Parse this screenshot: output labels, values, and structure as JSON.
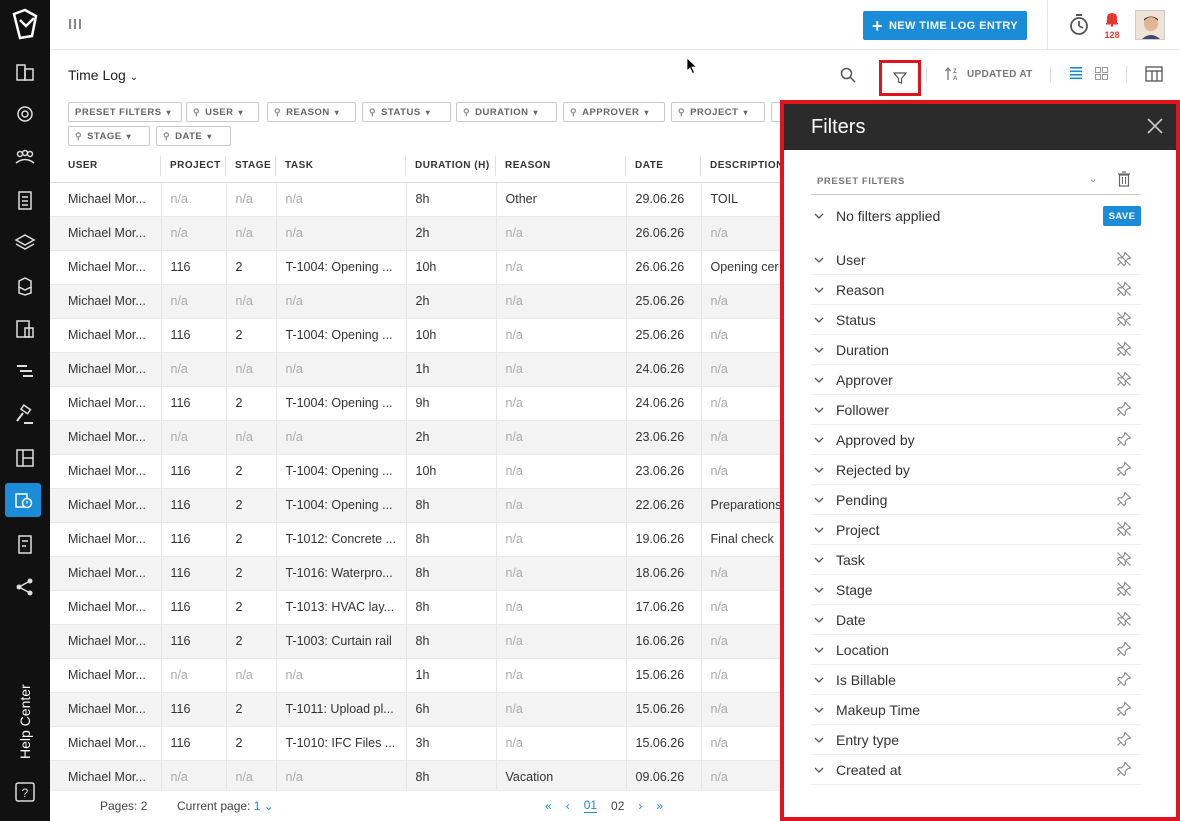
{
  "header": {
    "new_entry_label": "NEW TIME LOG ENTRY",
    "notification_count": "128"
  },
  "toolbar": {
    "page_title": "Time Log",
    "sort_label": "UPDATED AT"
  },
  "chips": {
    "preset": "PRESET FILTERS",
    "user": "USER",
    "reason": "REASON",
    "status": "STATUS",
    "duration": "DURATION",
    "approver": "APPROVER",
    "project": "PROJECT",
    "stage": "STAGE",
    "date": "DATE"
  },
  "table": {
    "headers": {
      "user": "USER",
      "project": "PROJECT",
      "stage": "STAGE",
      "task": "TASK",
      "duration": "DURATION (H)",
      "reason": "REASON",
      "date": "DATE",
      "description": "DESCRIPTION"
    },
    "rows": [
      {
        "user": "Michael Mor...",
        "project": "n/a",
        "stage": "n/a",
        "task": "n/a",
        "duration": "8h",
        "reason": "Other",
        "date": "29.06.26",
        "description": "TOIL"
      },
      {
        "user": "Michael Mor...",
        "project": "n/a",
        "stage": "n/a",
        "task": "n/a",
        "duration": "2h",
        "reason": "n/a",
        "date": "26.06.26",
        "description": "n/a"
      },
      {
        "user": "Michael Mor...",
        "project": "116",
        "stage": "2",
        "task": "T-1004: Opening ...",
        "duration": "10h",
        "reason": "n/a",
        "date": "26.06.26",
        "description": "Opening cer"
      },
      {
        "user": "Michael Mor...",
        "project": "n/a",
        "stage": "n/a",
        "task": "n/a",
        "duration": "2h",
        "reason": "n/a",
        "date": "25.06.26",
        "description": "n/a"
      },
      {
        "user": "Michael Mor...",
        "project": "116",
        "stage": "2",
        "task": "T-1004: Opening ...",
        "duration": "10h",
        "reason": "n/a",
        "date": "25.06.26",
        "description": "n/a"
      },
      {
        "user": "Michael Mor...",
        "project": "n/a",
        "stage": "n/a",
        "task": "n/a",
        "duration": "1h",
        "reason": "n/a",
        "date": "24.06.26",
        "description": "n/a"
      },
      {
        "user": "Michael Mor...",
        "project": "116",
        "stage": "2",
        "task": "T-1004: Opening ...",
        "duration": "9h",
        "reason": "n/a",
        "date": "24.06.26",
        "description": "n/a"
      },
      {
        "user": "Michael Mor...",
        "project": "n/a",
        "stage": "n/a",
        "task": "n/a",
        "duration": "2h",
        "reason": "n/a",
        "date": "23.06.26",
        "description": "n/a"
      },
      {
        "user": "Michael Mor...",
        "project": "116",
        "stage": "2",
        "task": "T-1004: Opening ...",
        "duration": "10h",
        "reason": "n/a",
        "date": "23.06.26",
        "description": "n/a"
      },
      {
        "user": "Michael Mor...",
        "project": "116",
        "stage": "2",
        "task": "T-1004: Opening ...",
        "duration": "8h",
        "reason": "n/a",
        "date": "22.06.26",
        "description": "Preparations"
      },
      {
        "user": "Michael Mor...",
        "project": "116",
        "stage": "2",
        "task": "T-1012: Concrete ...",
        "duration": "8h",
        "reason": "n/a",
        "date": "19.06.26",
        "description": "Final check"
      },
      {
        "user": "Michael Mor...",
        "project": "116",
        "stage": "2",
        "task": "T-1016: Waterpro...",
        "duration": "8h",
        "reason": "n/a",
        "date": "18.06.26",
        "description": "n/a"
      },
      {
        "user": "Michael Mor...",
        "project": "116",
        "stage": "2",
        "task": "T-1013: HVAC lay...",
        "duration": "8h",
        "reason": "n/a",
        "date": "17.06.26",
        "description": "n/a"
      },
      {
        "user": "Michael Mor...",
        "project": "116",
        "stage": "2",
        "task": "T-1003: Curtain rail",
        "duration": "8h",
        "reason": "n/a",
        "date": "16.06.26",
        "description": "n/a"
      },
      {
        "user": "Michael Mor...",
        "project": "n/a",
        "stage": "n/a",
        "task": "n/a",
        "duration": "1h",
        "reason": "n/a",
        "date": "15.06.26",
        "description": "n/a"
      },
      {
        "user": "Michael Mor...",
        "project": "116",
        "stage": "2",
        "task": "T-1011: Upload pl...",
        "duration": "6h",
        "reason": "n/a",
        "date": "15.06.26",
        "description": "n/a"
      },
      {
        "user": "Michael Mor...",
        "project": "116",
        "stage": "2",
        "task": "T-1010: IFC Files ...",
        "duration": "3h",
        "reason": "n/a",
        "date": "15.06.26",
        "description": "n/a"
      },
      {
        "user": "Michael Mor...",
        "project": "n/a",
        "stage": "n/a",
        "task": "n/a",
        "duration": "8h",
        "reason": "Vacation",
        "date": "09.06.26",
        "description": "n/a"
      }
    ]
  },
  "footer": {
    "pages_label": "Pages: 2",
    "current_page_label": "Current page:",
    "current_page_value": "1",
    "page_1": "01",
    "page_2": "02"
  },
  "sidebar": {
    "help_center": "Help Center"
  },
  "filters_panel": {
    "title": "Filters",
    "preset_label": "PRESET FILTERS",
    "no_filters": "No filters applied",
    "save_label": "SAVE",
    "items": [
      {
        "label": "User",
        "pinned": true
      },
      {
        "label": "Reason",
        "pinned": true
      },
      {
        "label": "Status",
        "pinned": true
      },
      {
        "label": "Duration",
        "pinned": true
      },
      {
        "label": "Approver",
        "pinned": true
      },
      {
        "label": "Follower",
        "pinned": false
      },
      {
        "label": "Approved by",
        "pinned": false
      },
      {
        "label": "Rejected by",
        "pinned": false
      },
      {
        "label": "Pending",
        "pinned": false
      },
      {
        "label": "Project",
        "pinned": true
      },
      {
        "label": "Task",
        "pinned": true
      },
      {
        "label": "Stage",
        "pinned": true
      },
      {
        "label": "Date",
        "pinned": true
      },
      {
        "label": "Location",
        "pinned": false
      },
      {
        "label": "Is Billable",
        "pinned": false
      },
      {
        "label": "Makeup Time",
        "pinned": false
      },
      {
        "label": "Entry type",
        "pinned": false
      },
      {
        "label": "Created at",
        "pinned": false
      }
    ]
  },
  "colors": {
    "accent": "#1a8cd8",
    "sidebar_bg": "#111111",
    "panel_header": "#2b2b2b",
    "highlight": "#e0141e",
    "bell": "#e53935"
  }
}
